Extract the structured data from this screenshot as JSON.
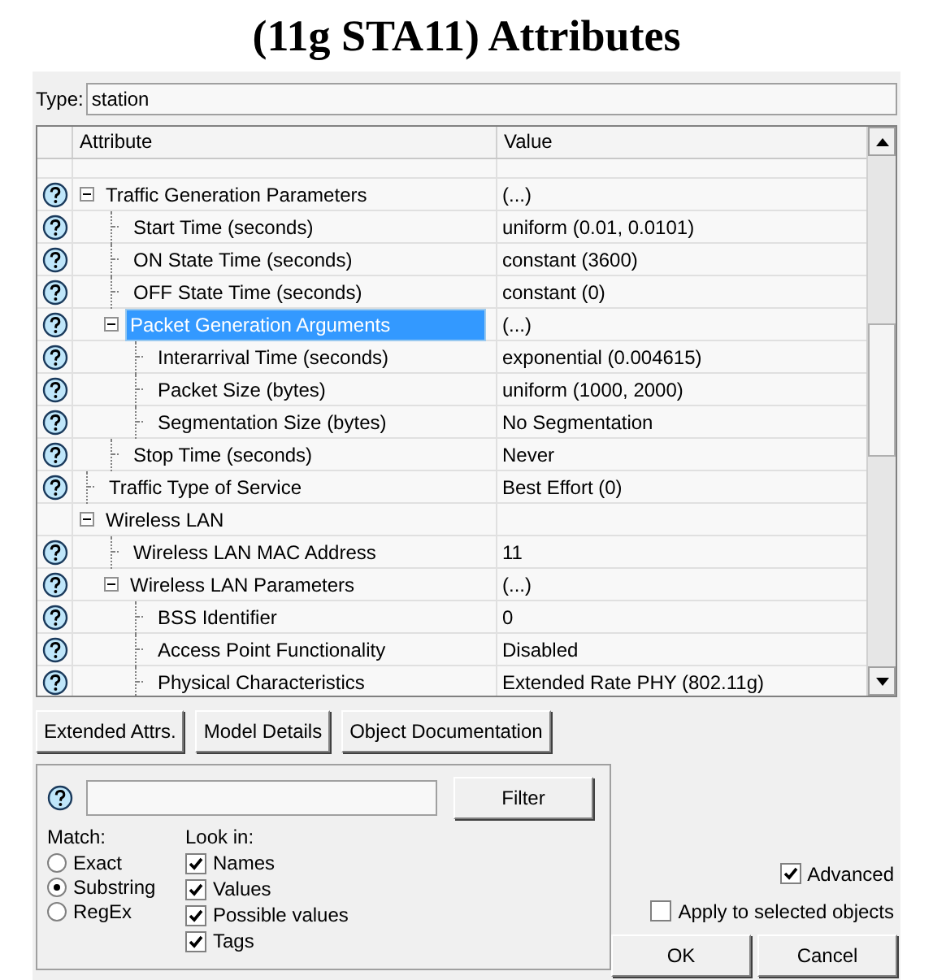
{
  "window": {
    "title": "(11g STA11) Attributes"
  },
  "type_field": {
    "label": "Type:",
    "value": "station"
  },
  "table": {
    "columns": [
      "Attribute",
      "Value"
    ],
    "rows": [
      {
        "name": "Traffic Generation Parameters",
        "value": "(...)",
        "help": true,
        "selected": false,
        "expanded": true,
        "children": [
          {
            "name": "Start Time (seconds)",
            "value": "uniform (0.01, 0.0101)",
            "help": true,
            "selected": false
          },
          {
            "name": "ON State Time (seconds)",
            "value": "constant (3600)",
            "help": true,
            "selected": false
          },
          {
            "name": "OFF State Time (seconds)",
            "value": "constant (0)",
            "help": true,
            "selected": false
          },
          {
            "name": "Packet Generation Arguments",
            "value": "(...)",
            "help": true,
            "selected": true,
            "expanded": true,
            "children": [
              {
                "name": "Interarrival Time (seconds)",
                "value": "exponential (0.004615)",
                "help": true,
                "selected": false
              },
              {
                "name": "Packet Size (bytes)",
                "value": "uniform (1000, 2000)",
                "help": true,
                "selected": false
              },
              {
                "name": "Segmentation Size (bytes)",
                "value": "No Segmentation",
                "help": true,
                "selected": false
              }
            ]
          },
          {
            "name": "Stop Time (seconds)",
            "value": "Never",
            "help": true,
            "selected": false
          }
        ]
      },
      {
        "name": "Traffic Type of Service",
        "value": "Best Effort (0)",
        "help": true,
        "selected": false
      },
      {
        "name": "Wireless LAN",
        "value": "",
        "help": false,
        "selected": false,
        "expanded": true,
        "children": [
          {
            "name": "Wireless LAN MAC Address",
            "value": "11",
            "help": true,
            "selected": false
          },
          {
            "name": "Wireless LAN Parameters",
            "value": "(...)",
            "help": true,
            "selected": false,
            "expanded": true,
            "children": [
              {
                "name": "BSS Identifier",
                "value": "0",
                "help": true,
                "selected": false
              },
              {
                "name": "Access Point Functionality",
                "value": "Disabled",
                "help": true,
                "selected": false
              },
              {
                "name": "Physical Characteristics",
                "value": "Extended Rate PHY (802.11g)",
                "help": true,
                "selected": false
              }
            ]
          }
        ]
      }
    ]
  },
  "buttons": [
    "Extended Attrs.",
    "Model Details",
    "Object Documentation"
  ],
  "filter": {
    "button": "Filter",
    "match_label": "Match:",
    "match": [
      {
        "label": "Exact",
        "selected": false
      },
      {
        "label": "Substring",
        "selected": true
      },
      {
        "label": "RegEx",
        "selected": false
      }
    ],
    "look_in_label": "Look in:",
    "look_in": [
      {
        "label": "Names",
        "checked": true
      },
      {
        "label": "Values",
        "checked": true
      },
      {
        "label": "Possible values",
        "checked": true
      },
      {
        "label": "Tags",
        "checked": true
      }
    ]
  },
  "options": [
    {
      "label": "Advanced",
      "checked": true
    },
    {
      "label": "Apply to selected objects",
      "checked": false
    }
  ],
  "dialog_buttons": [
    "OK",
    "Cancel"
  ]
}
